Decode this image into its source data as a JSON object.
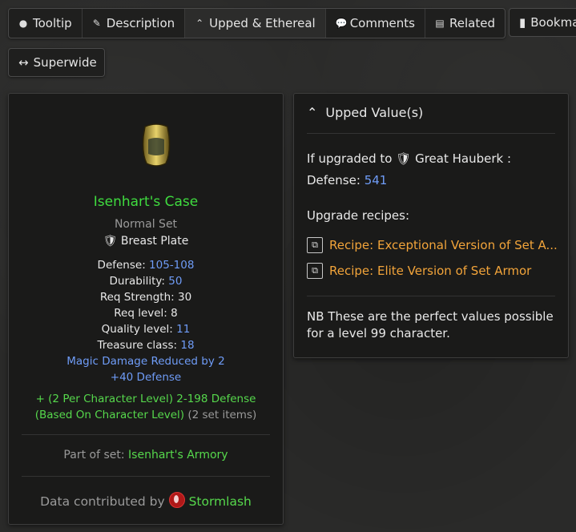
{
  "tabs": [
    {
      "label": "Tooltip",
      "icon": "drop-icon"
    },
    {
      "label": "Description",
      "icon": "quill-icon"
    },
    {
      "label": "Upped & Ethereal",
      "icon": "double-chevron-up-icon"
    },
    {
      "label": "Comments",
      "icon": "comments-icon"
    },
    {
      "label": "Related",
      "icon": "list-icon"
    }
  ],
  "bookmark_label": "Bookmark",
  "superwide_label": "Superwide",
  "item": {
    "name": "Isenhart's Case",
    "rarity": "Normal Set",
    "base": "Breast Plate",
    "defense_label": "Defense:",
    "defense_value": "105-108",
    "durability_label": "Durability:",
    "durability_value": "50",
    "req_strength": "Req Strength: 30",
    "req_level": "Req level: 8",
    "quality_label": "Quality level:",
    "quality_value": "11",
    "treasure_label": "Treasure class:",
    "treasure_value": "18",
    "mod1": "Magic Damage Reduced by 2",
    "mod2": "+40 Defense",
    "set_bonus": "+ (2 Per Character Level) 2-198 Defense (Based On Character Level)",
    "set_bonus_note": "(2 set items)",
    "set_label": "Part of set:",
    "set_name": "Isenhart's Armory",
    "contrib_label": "Data contributed by",
    "contributor": "Stormlash"
  },
  "upped": {
    "title": "Upped Value(s)",
    "if_upgraded": "If upgraded to",
    "target": "Great Hauberk",
    "colon": ":",
    "defense_label": "Defense:",
    "defense_value": "541",
    "recipes_label": "Upgrade recipes:",
    "recipe1": "Recipe: Exceptional Version of Set A...",
    "recipe2": "Recipe: Elite Version of Set Armor",
    "note": "NB These are the perfect values possible for a level 99 character."
  },
  "colors": {
    "set_green": "#3fdc3f",
    "magic_blue": "#6f9cf7",
    "recipe_orange": "#f2a43a"
  }
}
